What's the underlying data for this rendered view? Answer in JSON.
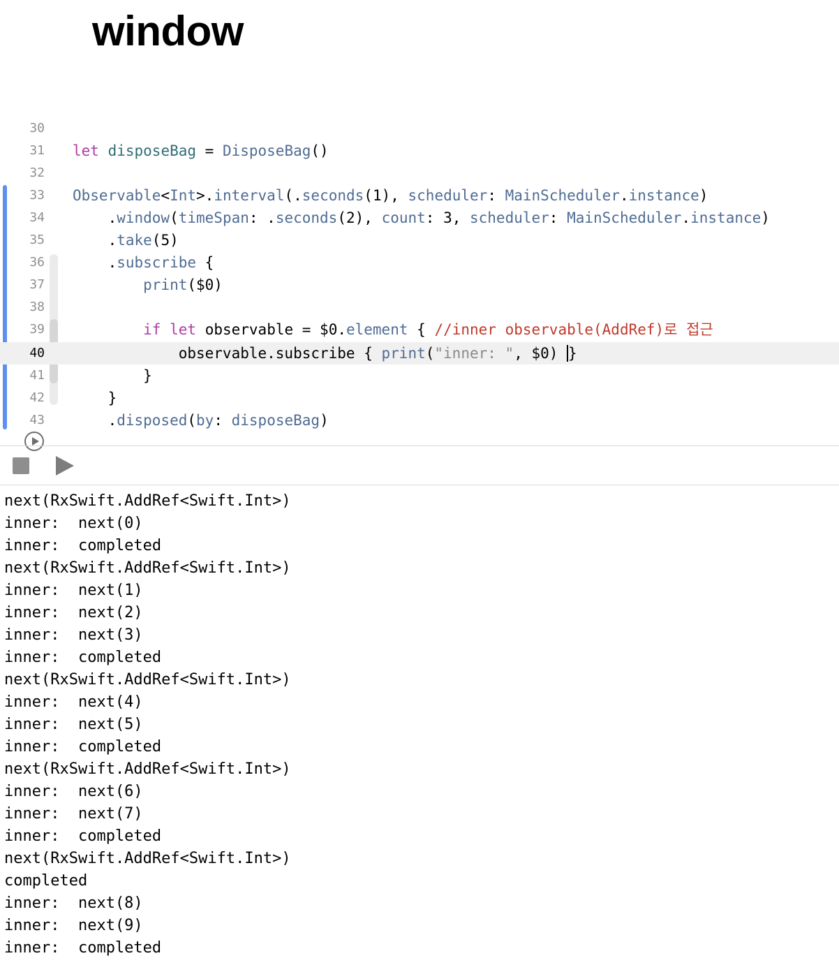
{
  "title": "window",
  "editor": {
    "lines": [
      {
        "n": "30",
        "tokens": []
      },
      {
        "n": "31",
        "tokens": [
          [
            "kw",
            "let"
          ],
          [
            "",
            ""
          ],
          [
            "id",
            " disposeBag"
          ],
          [
            "",
            " = "
          ],
          [
            "ty",
            "DisposeBag"
          ],
          [
            "",
            "()"
          ]
        ]
      },
      {
        "n": "32",
        "tokens": []
      },
      {
        "n": "33",
        "tokens": [
          [
            "ty",
            "Observable"
          ],
          [
            "",
            "<"
          ],
          [
            "ty",
            "Int"
          ],
          [
            "",
            ">."
          ],
          [
            "ty",
            "interval"
          ],
          [
            "",
            "(."
          ],
          [
            "ty",
            "seconds"
          ],
          [
            "",
            "(1), "
          ],
          [
            "ty",
            "scheduler"
          ],
          [
            "",
            ": "
          ],
          [
            "ty",
            "MainScheduler"
          ],
          [
            "",
            "."
          ],
          [
            "ty",
            "instance"
          ],
          [
            "",
            ")"
          ]
        ]
      },
      {
        "n": "34",
        "tokens": [
          [
            "",
            "    ."
          ],
          [
            "ty",
            "window"
          ],
          [
            "",
            "("
          ],
          [
            "ty",
            "timeSpan"
          ],
          [
            "",
            ": ."
          ],
          [
            "ty",
            "seconds"
          ],
          [
            "",
            "(2), "
          ],
          [
            "ty",
            "count"
          ],
          [
            "",
            ": 3, "
          ],
          [
            "ty",
            "scheduler"
          ],
          [
            "",
            ": "
          ],
          [
            "ty",
            "MainScheduler"
          ],
          [
            "",
            "."
          ],
          [
            "ty",
            "instance"
          ],
          [
            "",
            ")"
          ]
        ]
      },
      {
        "n": "35",
        "tokens": [
          [
            "",
            "    ."
          ],
          [
            "ty",
            "take"
          ],
          [
            "",
            "(5)"
          ]
        ]
      },
      {
        "n": "36",
        "tokens": [
          [
            "",
            "    ."
          ],
          [
            "ty",
            "subscribe"
          ],
          [
            "",
            " {"
          ]
        ]
      },
      {
        "n": "37",
        "tokens": [
          [
            "",
            "        "
          ],
          [
            "ty",
            "print"
          ],
          [
            "",
            "($0)"
          ]
        ]
      },
      {
        "n": "38",
        "tokens": []
      },
      {
        "n": "39",
        "tokens": [
          [
            "",
            "        "
          ],
          [
            "kw",
            "if"
          ],
          [
            "",
            " "
          ],
          [
            "kw",
            "let"
          ],
          [
            "",
            " observable = $0."
          ],
          [
            "ty",
            "element"
          ],
          [
            "",
            " { "
          ],
          [
            "cm",
            "//inner observable(AddRef)로 접근"
          ]
        ]
      },
      {
        "n": "40",
        "tokens": [
          [
            "",
            "            observable.subscribe { "
          ],
          [
            "ty",
            "print"
          ],
          [
            "",
            "("
          ],
          [
            "st",
            "\"inner: \""
          ],
          [
            "",
            ", $0) "
          ],
          [
            "cursor",
            "}"
          ]
        ]
      },
      {
        "n": "41",
        "tokens": [
          [
            "",
            "        }"
          ]
        ]
      },
      {
        "n": "42",
        "tokens": [
          [
            "",
            "    }"
          ]
        ]
      },
      {
        "n": "43",
        "tokens": [
          [
            "",
            "    ."
          ],
          [
            "ty",
            "disposed"
          ],
          [
            "",
            "("
          ],
          [
            "ty",
            "by"
          ],
          [
            "",
            ": "
          ],
          [
            "ty",
            "disposeBag"
          ],
          [
            "",
            ")"
          ]
        ]
      }
    ],
    "current_line": "40"
  },
  "toolbar": {
    "stop_icon": "stop-icon",
    "run_icon": "play-icon"
  },
  "console": {
    "lines": [
      "next(RxSwift.AddRef<Swift.Int>)",
      "inner:  next(0)",
      "inner:  completed",
      "next(RxSwift.AddRef<Swift.Int>)",
      "inner:  next(1)",
      "inner:  next(2)",
      "inner:  next(3)",
      "inner:  completed",
      "next(RxSwift.AddRef<Swift.Int>)",
      "inner:  next(4)",
      "inner:  next(5)",
      "inner:  completed",
      "next(RxSwift.AddRef<Swift.Int>)",
      "inner:  next(6)",
      "inner:  next(7)",
      "inner:  completed",
      "next(RxSwift.AddRef<Swift.Int>)",
      "completed",
      "inner:  next(8)",
      "inner:  next(9)",
      "inner:  completed"
    ]
  }
}
